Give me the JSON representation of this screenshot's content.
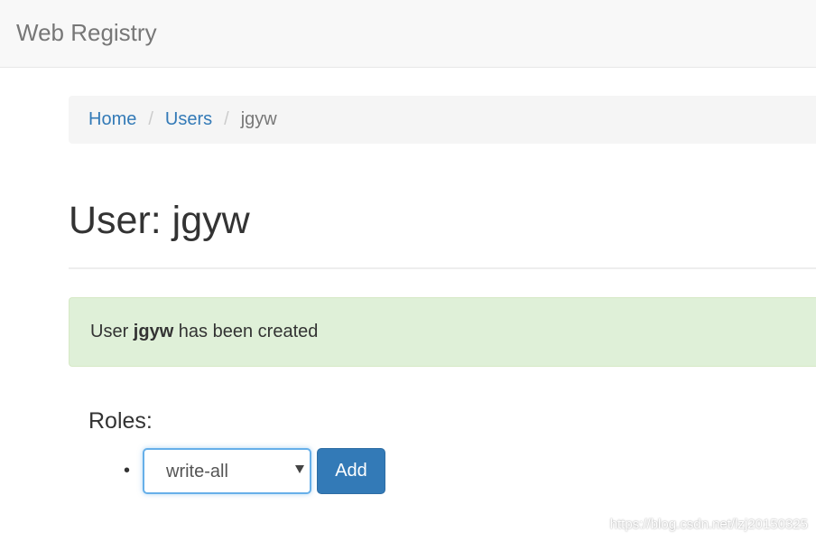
{
  "navbar": {
    "brand": "Web Registry"
  },
  "breadcrumb": {
    "items": [
      {
        "label": "Home",
        "active": false
      },
      {
        "label": "Users",
        "active": false
      },
      {
        "label": "jgyw",
        "active": true
      }
    ],
    "separator": "/"
  },
  "page": {
    "title": "User: jgyw"
  },
  "alert": {
    "prefix": "User ",
    "username": "jgyw",
    "suffix": " has been created"
  },
  "roles": {
    "label": "Roles:",
    "bullet": "•",
    "select_value": "write-all",
    "add_label": "Add"
  },
  "watermark": "https://blog.csdn.net/lzj20150325",
  "colors": {
    "link": "#337ab7",
    "primary_button": "#337ab7",
    "alert_success_bg": "#dff0d8",
    "navbar_bg": "#f8f8f8"
  },
  "icons": {
    "select_arrow": "chevron-down-icon"
  }
}
